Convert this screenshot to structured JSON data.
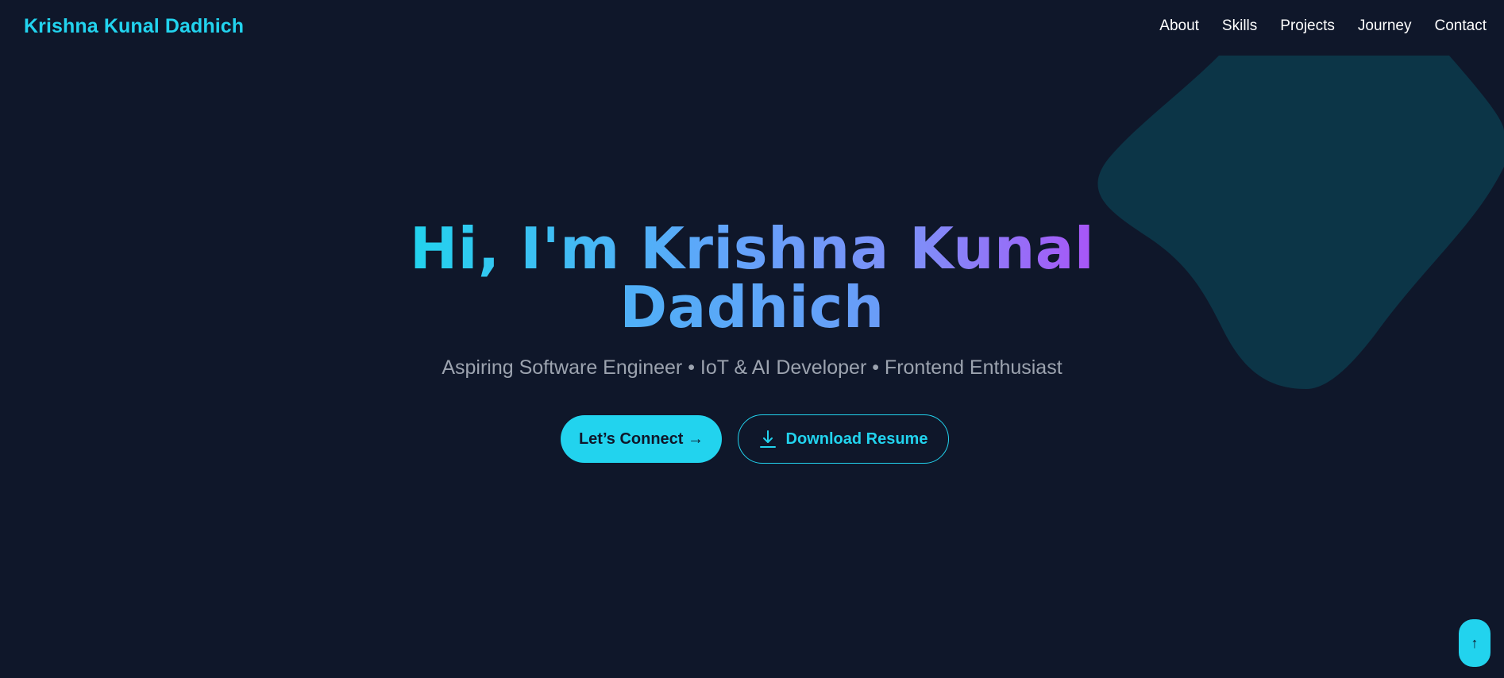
{
  "header": {
    "brand": "Krishna Kunal Dadhich",
    "nav": [
      "About",
      "Skills",
      "Projects",
      "Journey",
      "Contact"
    ]
  },
  "hero": {
    "title_line1": "Hi, I'm Krishna Kunal",
    "title_line2": "Dadhich",
    "subtitle": "Aspiring Software Engineer • IoT & AI Developer • Frontend Enthusiast",
    "connect_label": "Let’s Connect →",
    "resume_label": "Download Resume"
  },
  "scroll_top": {
    "label": "↑"
  },
  "colors": {
    "background": "#0f172a",
    "accent": "#22d3ee",
    "blob": "#0c3547",
    "text": "#ffffff",
    "muted": "#9ca3af",
    "gradient_end": "#a855f7"
  },
  "icons": {
    "resume_button": "download-icon",
    "scroll_button": "arrow-up-icon"
  }
}
